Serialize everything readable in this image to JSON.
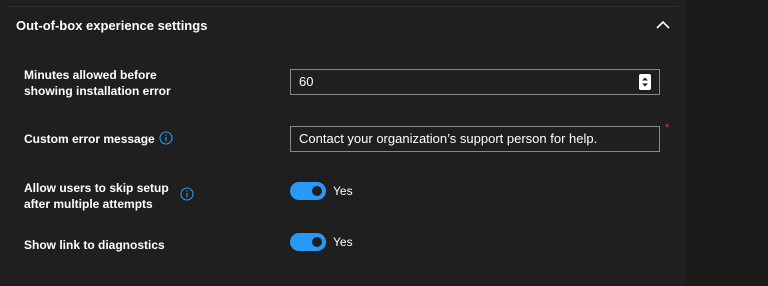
{
  "section": {
    "title": "Out-of-box experience settings",
    "expanded": true
  },
  "rows": {
    "minutes": {
      "label_line1": "Minutes allowed before",
      "label_line2": "showing installation error",
      "value": "60"
    },
    "error_message": {
      "label": "Custom error message",
      "value": "Contact your organization’s support person for help.",
      "required_mark": "*"
    },
    "skip_setup": {
      "label_line1": "Allow users to skip setup",
      "label_line2": "after multiple attempts",
      "toggle_on": true,
      "toggle_label": "Yes"
    },
    "diagnostics": {
      "label": "Show link to diagnostics",
      "toggle_on": true,
      "toggle_label": "Yes"
    }
  },
  "colors": {
    "accent": "#2899f5",
    "background": "#1f1f1f",
    "required": "#e04040"
  }
}
